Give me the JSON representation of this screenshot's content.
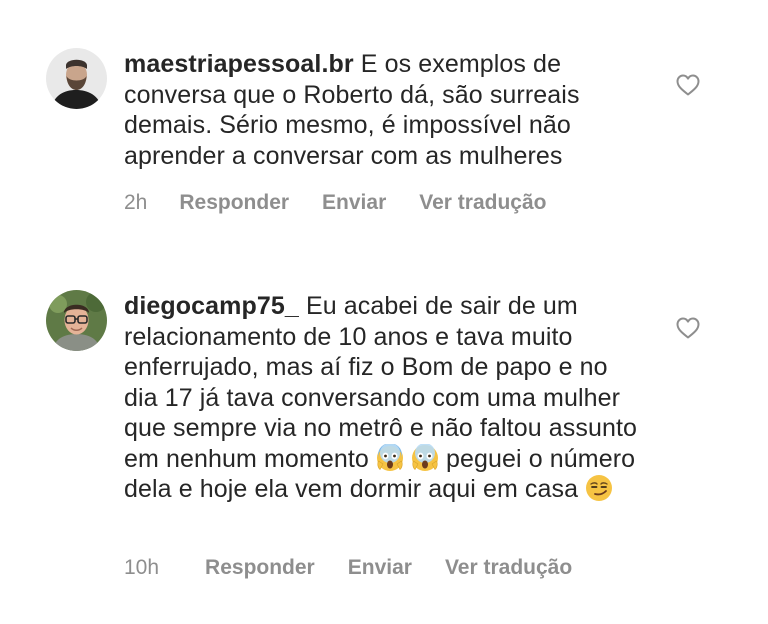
{
  "comments": [
    {
      "username": "maestriapessoal.br",
      "text": "E os exemplos de conversa que o Roberto dá, são surreais demais. Sério mesmo, é impossível não aprender a conversar com as mulheres",
      "time": "2h",
      "actions": {
        "reply": "Responder",
        "send": "Enviar",
        "translate": "Ver tradução"
      },
      "avatar_icon": "avatar-bearded-man",
      "like_icon": "heart-outline-icon"
    },
    {
      "username": "diegocamp75_",
      "text_part1": "Eu acabei de sair de um relacionamento de 10 anos e tava muito enferrujado, mas aí fiz o Bom de papo e no dia 17 já tava conversando com uma mulher que sempre via no metrô e não faltou assunto em nenhum momento",
      "text_part2": "peguei o número dela e hoje ela vem dormir aqui em casa",
      "emojis": [
        "face-screaming-in-fear",
        "face-screaming-in-fear",
        "smirking-face"
      ],
      "time": "10h",
      "actions": {
        "reply": "Responder",
        "send": "Enviar",
        "translate": "Ver tradução"
      },
      "avatar_icon": "avatar-man-glasses",
      "like_icon": "heart-outline-icon"
    }
  ],
  "colors": {
    "text": "#262626",
    "meta": "#8e8e8e",
    "background": "#ffffff"
  }
}
